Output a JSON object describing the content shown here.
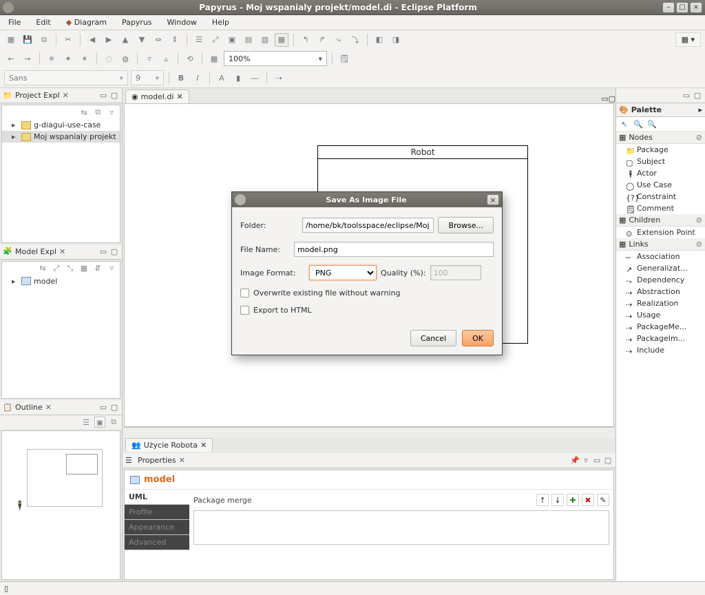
{
  "window": {
    "title": "Papyrus - Moj wspanialy projekt/model.di - Eclipse Platform"
  },
  "menubar": [
    "File",
    "Edit",
    "Diagram",
    "Papyrus",
    "Window",
    "Help"
  ],
  "toolbar": {
    "zoom": "100%",
    "font": "Sans",
    "font_size": "9"
  },
  "projectExplorer": {
    "title": "Project Expl",
    "items": [
      {
        "label": "g-diagui-use-case",
        "selected": false
      },
      {
        "label": "Moj wspanialy projekt",
        "selected": true
      }
    ]
  },
  "modelExplorer": {
    "title": "Model Expl",
    "items": [
      {
        "label": "model"
      }
    ]
  },
  "outline": {
    "title": "Outline"
  },
  "editor": {
    "tab": "model.di",
    "element_label": "Robot",
    "bottom_tab": "Użycie Robota"
  },
  "palette": {
    "title": "Palette",
    "groups": [
      {
        "header": "Nodes",
        "items": [
          "Package",
          "Subject",
          "Actor",
          "Use Case",
          "Constraint",
          "Comment"
        ]
      },
      {
        "header": "Children",
        "items": [
          "Extension Point"
        ]
      },
      {
        "header": "Links",
        "items": [
          "Association",
          "Generalizat...",
          "Dependency",
          "Abstraction",
          "Realization",
          "Usage",
          "PackageMe...",
          "PackageIm...",
          "Include"
        ]
      }
    ]
  },
  "properties": {
    "title": "Properties",
    "model_name": "model",
    "tabs": [
      "UML",
      "Profile",
      "Appearance",
      "Advanced"
    ],
    "label": "Package merge"
  },
  "dialog": {
    "title": "Save As Image File",
    "folder_label": "Folder:",
    "folder_value": "/home/bk/toolsspace/eclipse/Moj wspa",
    "browse": "Browse...",
    "filename_label": "File Name:",
    "filename_value": "model.png",
    "format_label": "Image Format:",
    "format_value": "PNG",
    "quality_label": "Quality (%):",
    "quality_value": "100",
    "overwrite": "Overwrite existing file without warning",
    "export_html": "Export to HTML",
    "cancel": "Cancel",
    "ok": "OK"
  }
}
